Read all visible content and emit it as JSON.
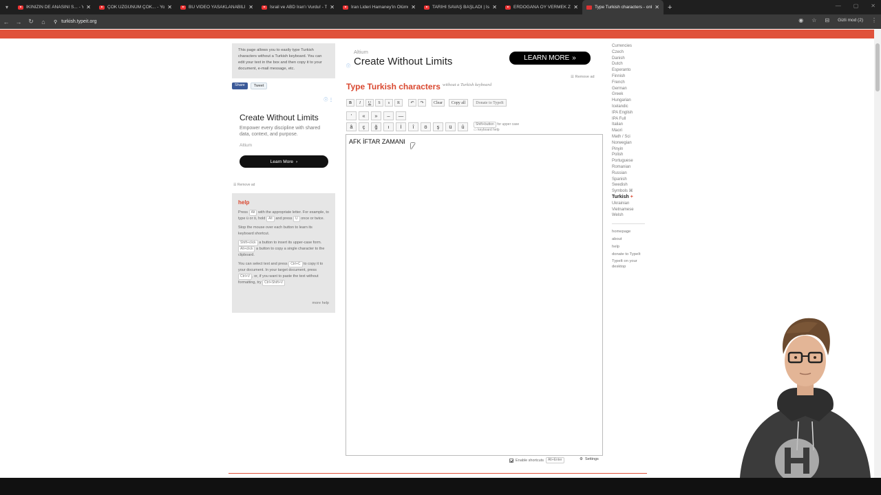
{
  "browser": {
    "tabs": [
      {
        "title": "İKİNİZİN DE ANASINI S... - YouT..."
      },
      {
        "title": "ÇOK ÜZGÜNÜM ÇOK... - YouTu..."
      },
      {
        "title": "BU VİDEO YASAKLANABİLİR. (B..."
      },
      {
        "title": "İsrail ve ABD İran'ı Vurdu! - Tüm..."
      },
      {
        "title": "İran Lideri Hamaney'in Ölümü"
      },
      {
        "title": "TARİHİ SAVAŞ BAŞLADI | İsrail"
      },
      {
        "title": "ERDOĞANA OY VERMEK ZORU..."
      },
      {
        "title": "Type Turkish characters - onlin..."
      }
    ],
    "url": "turkish.typeit.org",
    "incognito_label": "Gizli mod (2)",
    "accent": "#e0523b"
  },
  "intro": {
    "text": "This page allows you to easily type Turkish characters without a Turkish keyboard. You can edit your text in the box and then copy it to your document, e-mail message, etc."
  },
  "share": {
    "facebook": "Share",
    "twitter": "Tweet"
  },
  "ad_left": {
    "headline": "Create Without Limits",
    "description": "Empower every discipline with shared data, context, and purpose.",
    "brand": "Altium",
    "button": "Learn More",
    "remove": "Remove ad"
  },
  "ad_top": {
    "brand": "Altium",
    "headline": "Create Without Limits",
    "button": "LEARN MORE",
    "remove": "Remove ad"
  },
  "help": {
    "title": "help",
    "p1_a": "Press",
    "p1_key": "Alt",
    "p1_b": "with the appropriate letter. For example, to type ü or ö, hold",
    "p1_key2": "Alt",
    "p1_c": "and press",
    "p1_key3": "U",
    "p1_d": "once or twice.",
    "p2": "Stop the mouse over each button to learn its keyboard shortcut.",
    "p3_key": "Shift+click",
    "p3_a": "a button to insert its upper-case form.",
    "p3_key2": "Alt+click",
    "p3_b": "a button to copy a single character to the clipboard.",
    "p4_a": "You can select text and press",
    "p4_key": "Ctrl+C",
    "p4_b": "to copy it to your document. In your target document, press",
    "p4_key2": "Ctrl+V",
    "p4_c": ", or, if you want to paste the text without formatting, try",
    "p4_key3": "Ctrl+Shift+V",
    "more": "more help"
  },
  "main": {
    "title": "Type Turkish characters",
    "subtitle": "without a Turkish keyboard",
    "format_buttons": [
      "B",
      "I",
      "U",
      "S",
      "s",
      "R"
    ],
    "undo": "↶",
    "redo": "↷",
    "clear": "Clear",
    "copy_all": "Copy all",
    "donate": "Donate to TypeIt",
    "symbol_buttons": [
      "'",
      "«",
      "»",
      "–",
      "—"
    ],
    "char_buttons": [
      "â",
      "ç",
      "ğ",
      "ı",
      "İ",
      "î",
      "ö",
      "ş",
      "ü",
      "û"
    ],
    "shift_note_key": "Shift+button",
    "shift_note": "for upper case",
    "keyboard_help": "keyboard help",
    "editor_text": "AFK İFTAR ZAMANI",
    "enable_shortcuts": "Enable shortcuts",
    "shortcut_key": "Alt+Enter",
    "settings": "Settings"
  },
  "languages": [
    "Currencies",
    "Czech",
    "Danish",
    "Dutch",
    "Esperanto",
    "Finnish",
    "French",
    "German",
    "Greek",
    "Hungarian",
    "Icelandic",
    "IPA English",
    "IPA Full",
    "Italian",
    "Maori",
    "Math / Sci",
    "Norwegian",
    "Pinyin",
    "Polish",
    "Portuguese",
    "Romanian",
    "Russian",
    "Spanish",
    "Swedish",
    "Symbols ⌘"
  ],
  "current_language": "Turkish",
  "languages_after": [
    "Ukrainian",
    "Vietnamese",
    "Welsh"
  ],
  "links": [
    "homepage",
    "about",
    "help",
    "donate to TypeIt",
    "TypeIt on your desktop"
  ]
}
